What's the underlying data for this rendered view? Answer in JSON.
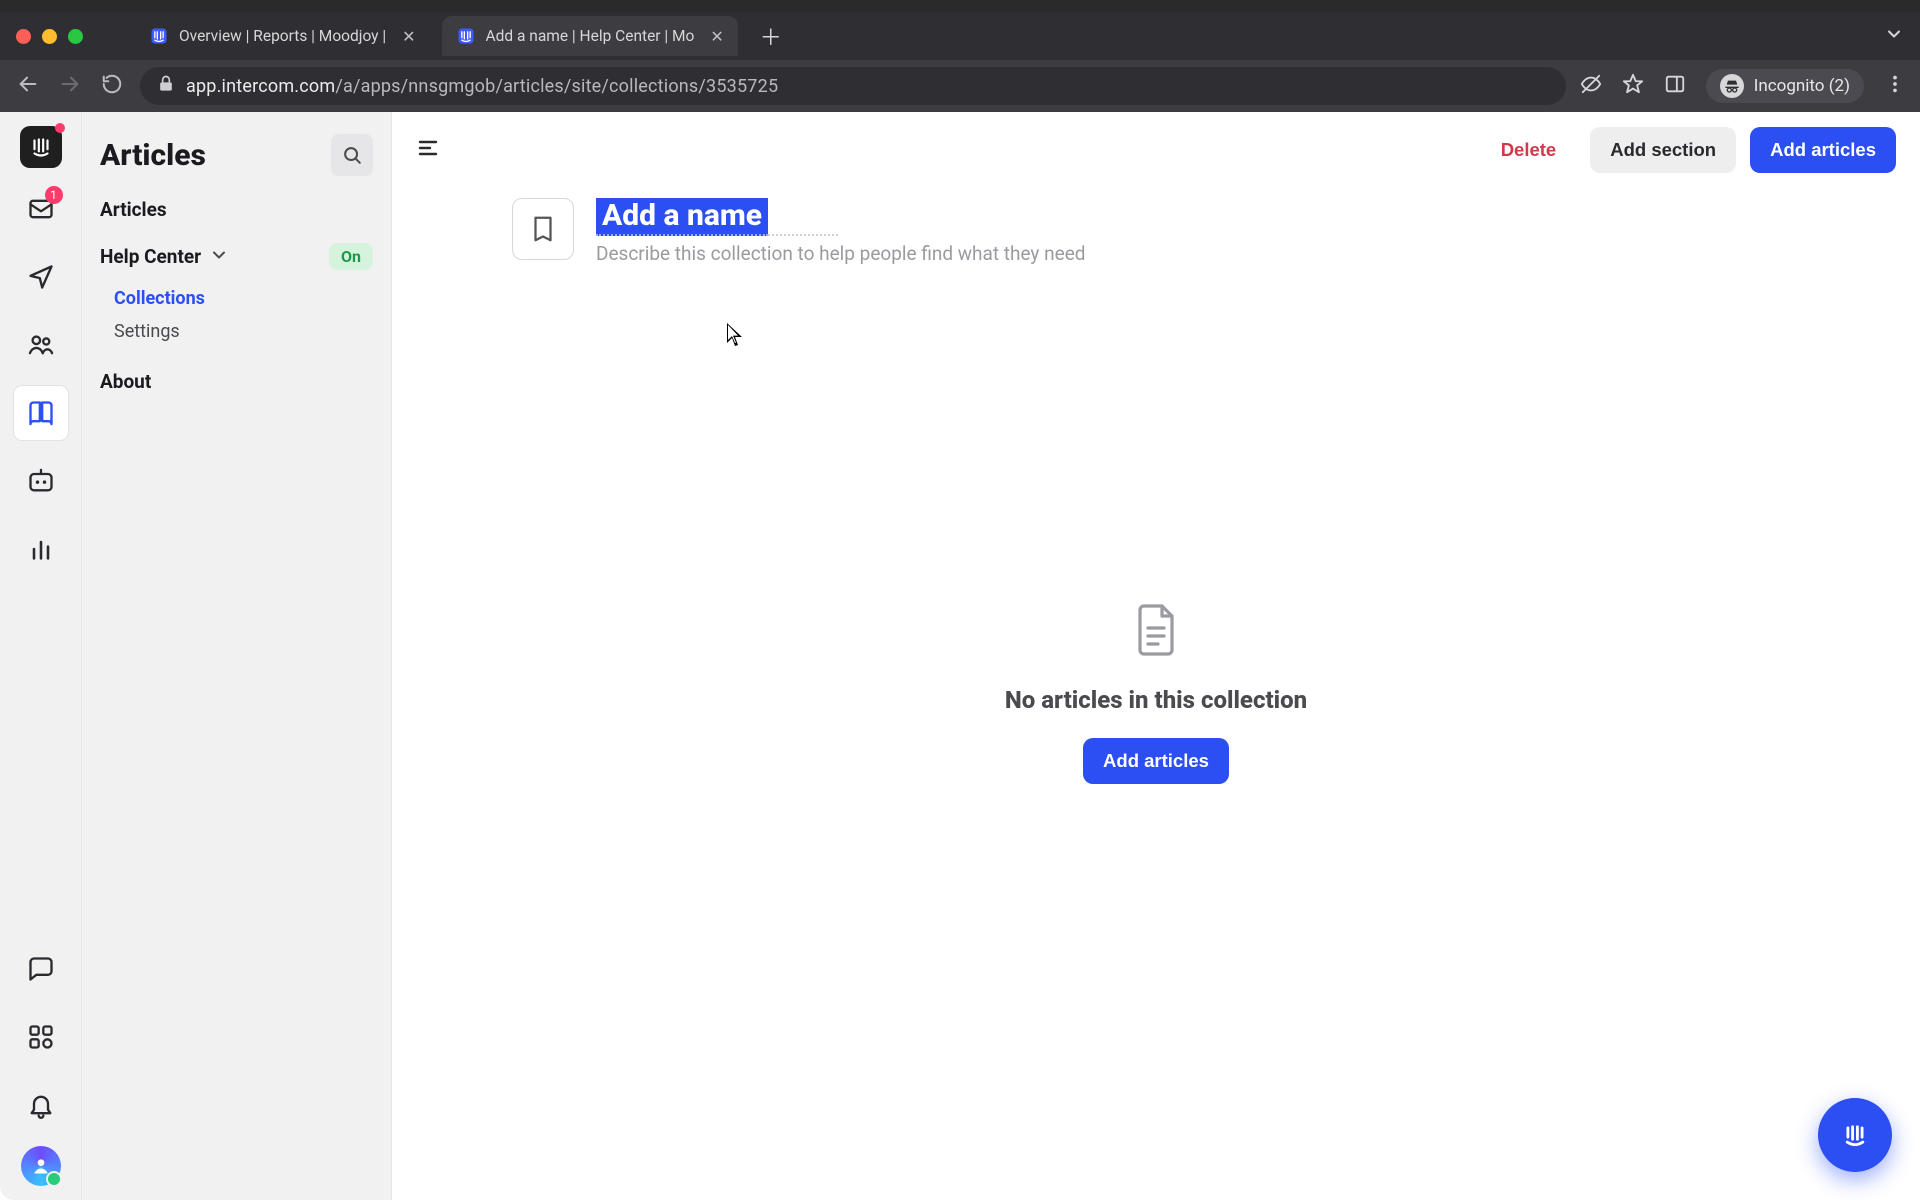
{
  "browser": {
    "tabs": [
      {
        "title": "Overview | Reports | Moodjoy |",
        "active": false
      },
      {
        "title": "Add a name | Help Center | Mo",
        "active": true
      }
    ],
    "url_host": "app.intercom.com",
    "url_path": "/a/apps/nnsgmgob/articles/site/collections/3535725",
    "incognito_label": "Incognito (2)"
  },
  "rail": {
    "inbox_badge": "1"
  },
  "side": {
    "title": "Articles",
    "section_articles": "Articles",
    "help_center_label": "Help Center",
    "status_on": "On",
    "link_collections": "Collections",
    "link_settings": "Settings",
    "section_about": "About"
  },
  "toolbar": {
    "delete": "Delete",
    "add_section": "Add section",
    "add_articles": "Add articles"
  },
  "collection": {
    "title_placeholder": "Add a name",
    "description_placeholder": "Describe this collection to help people find what they need"
  },
  "empty": {
    "heading": "No articles in this collection",
    "cta": "Add articles"
  }
}
